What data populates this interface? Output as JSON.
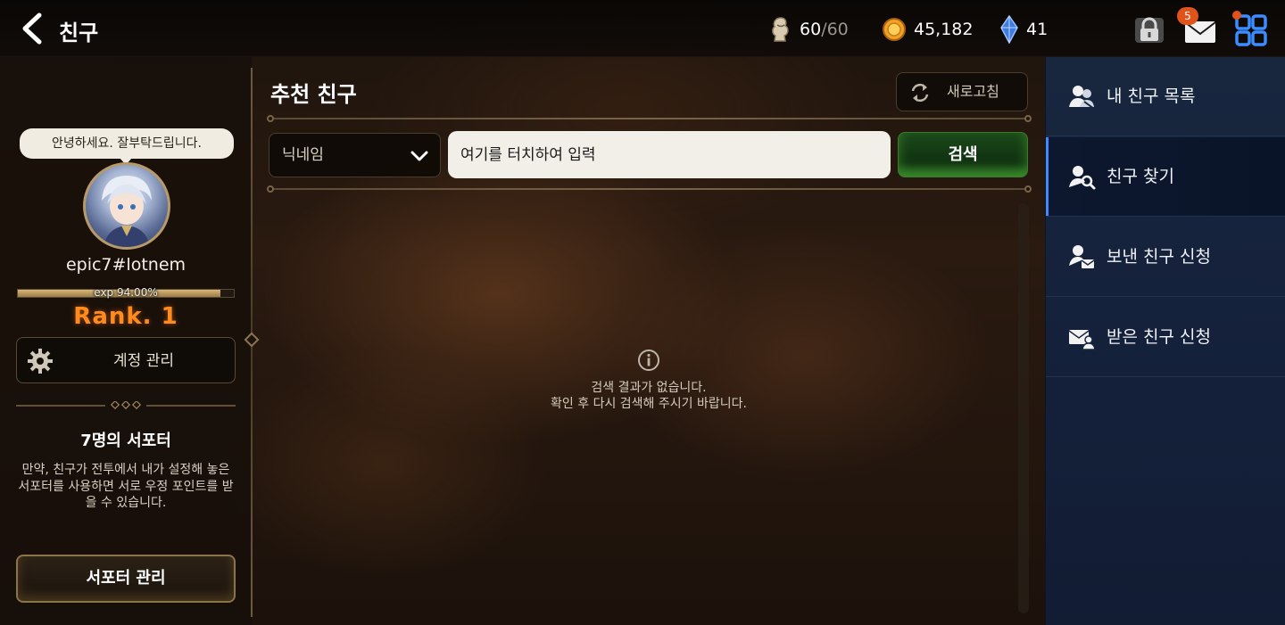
{
  "header": {
    "title": "친구",
    "stamina": {
      "current": "60",
      "max": "/60"
    },
    "gold": "45,182",
    "gems": "41",
    "mail_badge": "5"
  },
  "profile": {
    "greeting": "안녕하세요. 잘부탁드립니다.",
    "nickname": "epic7#lotnem",
    "exp_text": "exp 94.00%",
    "exp_fraction": 0.94,
    "rank": "Rank.  1",
    "account_button": "계정 관리"
  },
  "supporter": {
    "title": "7명의 서포터",
    "description": "만약, 친구가 전투에서 내가 설정해 놓은 서포터를 사용하면 서로 우정 포인트를 받을 수 있습니다.",
    "manage_button": "서포터 관리"
  },
  "main": {
    "title": "추천 친구",
    "refresh_button": "새로고침",
    "filter_selected": "닉네임",
    "search_placeholder": "여기를 터치하여 입력",
    "search_button": "검색",
    "empty_line1": "검색 결과가 없습니다.",
    "empty_line2": "확인 후 다시 검색해 주시기 바랍니다."
  },
  "sidebar": {
    "items": [
      {
        "label": "내 친구 목록",
        "icon": "friends-list-icon",
        "active": false
      },
      {
        "label": "친구 찾기",
        "icon": "find-friend-icon",
        "active": true
      },
      {
        "label": "보낸 친구 신청",
        "icon": "sent-request-icon",
        "active": false
      },
      {
        "label": "받은 친구 신청",
        "icon": "received-request-icon",
        "active": false
      }
    ]
  },
  "colors": {
    "rank": "#ff8a1d",
    "accent_blue": "#3e8bff",
    "search_green": "#1f5a1e",
    "badge": "#e0531b"
  }
}
